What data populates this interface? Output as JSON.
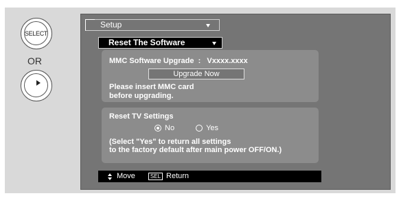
{
  "remote": {
    "select_label": "SELECT",
    "or_label": "OR"
  },
  "menu": {
    "setup_label": "Setup",
    "submenu_label": "Reset The Software"
  },
  "mmc": {
    "title": "MMC Software Upgrade  :   Vxxxx.xxxx",
    "button_label": "Upgrade Now",
    "message_line1": "Please insert MMC card",
    "message_line2": "before upgrading."
  },
  "reset_tv": {
    "title": "Reset TV Settings",
    "options": [
      {
        "label": "No",
        "checked": true
      },
      {
        "label": "Yes",
        "checked": false
      }
    ],
    "note_line1": "(Select \"Yes\" to return all settings",
    "note_line2": "to the factory default after main power OFF/ON.)"
  },
  "status_bar": {
    "move_label": "Move",
    "sel_icon_text": "SEL",
    "return_label": "Return"
  },
  "icons": {
    "select_button": "select-button-icon",
    "nav_button": "navigation-ring-icon",
    "move": "up-down-arrows-icon",
    "sel": "sel-key-icon"
  }
}
